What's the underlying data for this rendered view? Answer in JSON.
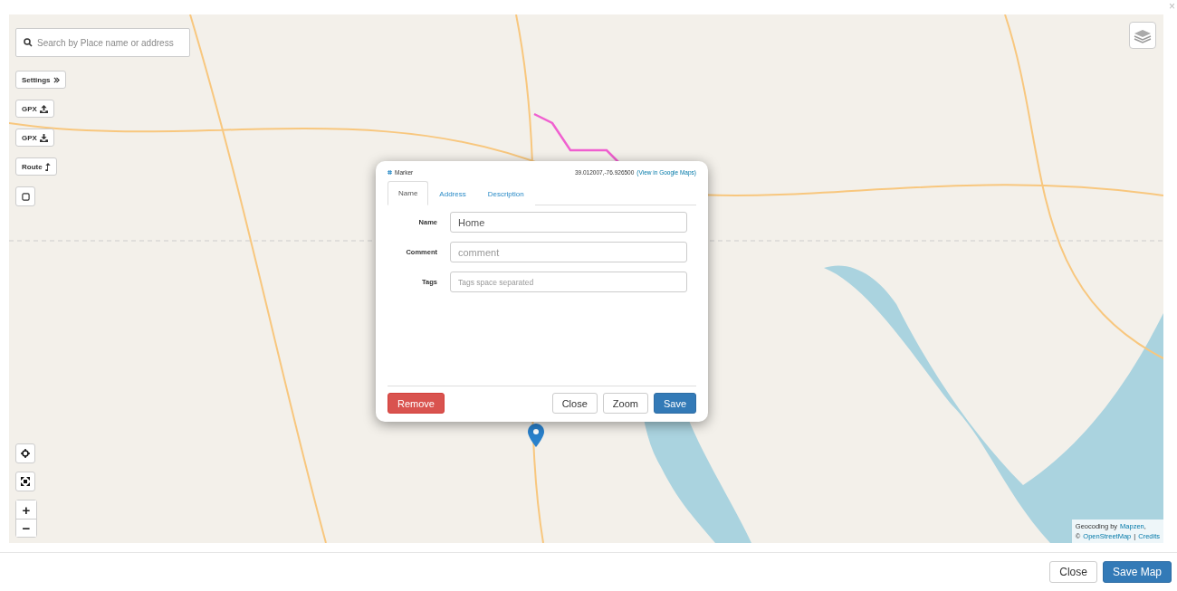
{
  "dialog_close": "×",
  "search": {
    "placeholder": "Search by Place name or address"
  },
  "map_controls": [
    {
      "kind": "settings",
      "label": "Settings"
    },
    {
      "kind": "upload",
      "label": "GPX"
    },
    {
      "kind": "download",
      "label": "GPX"
    },
    {
      "kind": "route",
      "label": "Route"
    },
    {
      "kind": "square"
    }
  ],
  "zoom": {
    "in": "+",
    "out": "−"
  },
  "popup": {
    "type": "Marker",
    "coordinates": "39.012007,-76.926500",
    "link": "(View in Google Maps)",
    "tabs": [
      {
        "label": "Name",
        "selected": true
      },
      {
        "label": "Address",
        "selected": false
      },
      {
        "label": "Description",
        "selected": false
      }
    ],
    "fields": [
      {
        "label": "Name",
        "value": "Home"
      },
      {
        "label": "Comment",
        "placeholder": "comment"
      },
      {
        "label": "Tags",
        "placeholder": "Tags space separated",
        "small": true
      }
    ],
    "buttons": [
      {
        "label": "Remove",
        "kind": "danger"
      },
      {
        "label": "Close",
        "kind": "default"
      },
      {
        "label": "Zoom",
        "kind": "default"
      },
      {
        "label": "Save",
        "kind": "primary"
      }
    ]
  },
  "attribution": {
    "prefix": "Geocoding by",
    "geocoder": "Mapzen",
    "separator": ",",
    "copyright": "©",
    "osm": "OpenStreetMap",
    "divider": "|",
    "credits": "Credits"
  },
  "footer_buttons": [
    {
      "label": "Close",
      "kind": "default"
    },
    {
      "label": "Save Map",
      "kind": "primary"
    }
  ]
}
